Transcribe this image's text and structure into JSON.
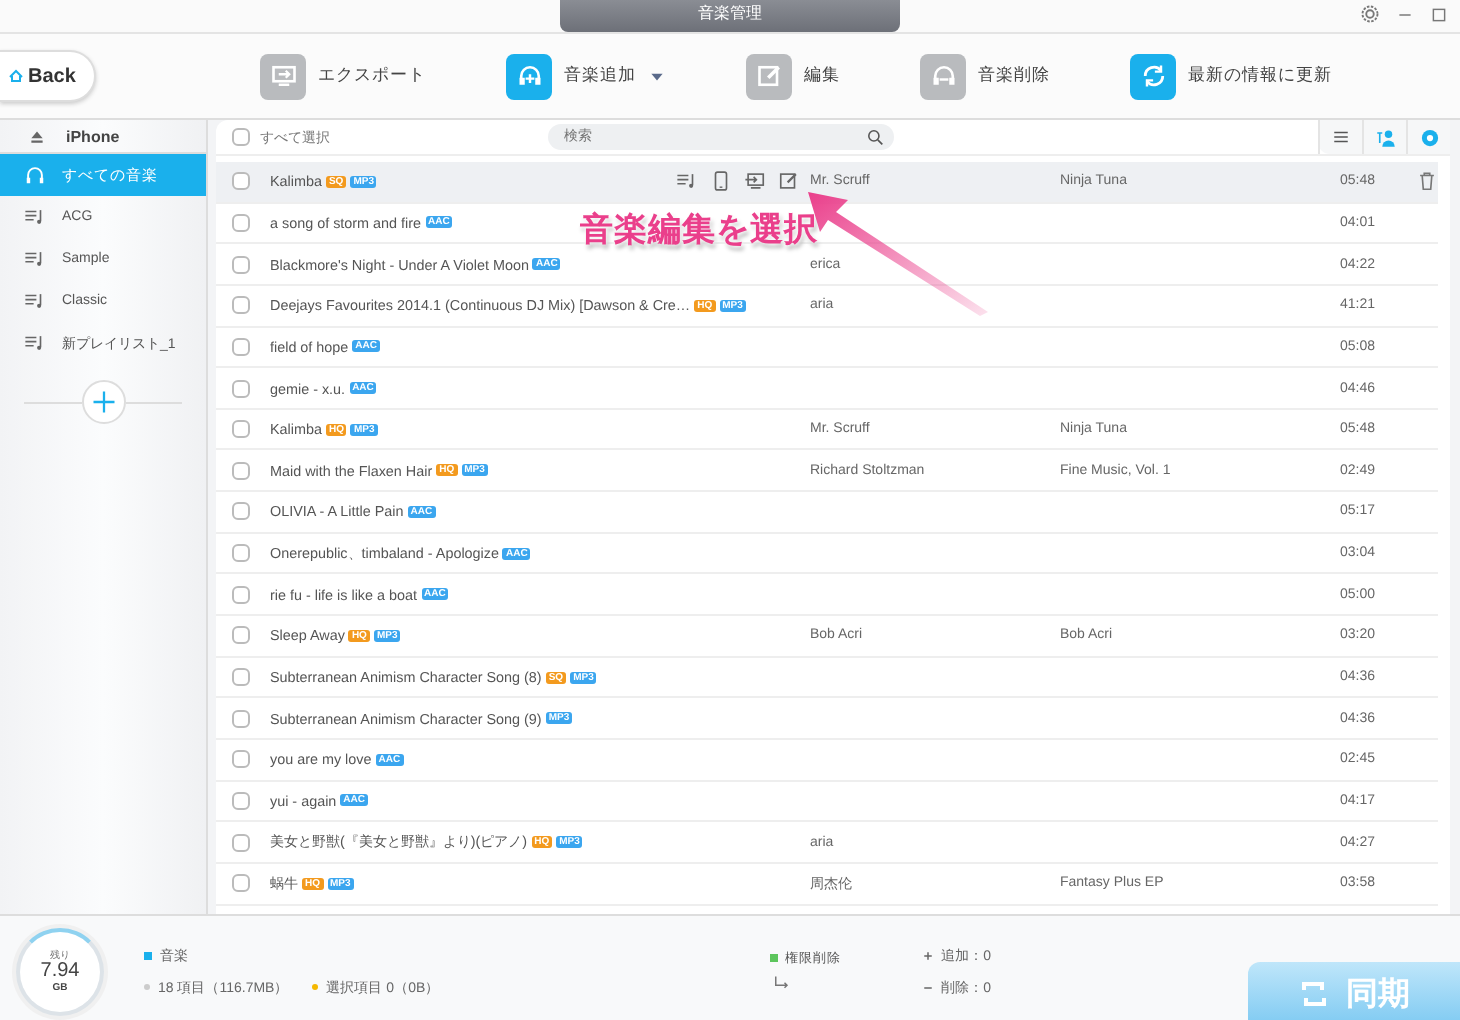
{
  "window": {
    "title": "音楽管理"
  },
  "toolbar": {
    "back": "Back",
    "items": [
      {
        "kind": "export",
        "label": "エクスポート",
        "disabled": true,
        "dropdown": false
      },
      {
        "kind": "add",
        "label": "音楽追加",
        "disabled": false,
        "dropdown": true
      },
      {
        "kind": "edit",
        "label": "編集",
        "disabled": true,
        "dropdown": false
      },
      {
        "kind": "delete",
        "label": "音楽削除",
        "disabled": true,
        "dropdown": false
      },
      {
        "kind": "refresh",
        "label": "最新の情報に更新",
        "disabled": false,
        "dropdown": false
      }
    ]
  },
  "sidebar": {
    "device": "iPhone",
    "items": [
      {
        "kind": "all",
        "label": "すべての音楽",
        "selected": true
      },
      {
        "kind": "playlist",
        "label": "ACG",
        "selected": false
      },
      {
        "kind": "playlist",
        "label": "Sample",
        "selected": false
      },
      {
        "kind": "playlist",
        "label": "Classic",
        "selected": false
      },
      {
        "kind": "playlist",
        "label": "新プレイリスト_1",
        "selected": false
      }
    ]
  },
  "list_header": {
    "select_all": {
      "label": "すべて選択",
      "checked": false
    },
    "search": {
      "placeholder": "検索"
    }
  },
  "rows": [
    {
      "title": "Kalimba",
      "tags": [
        {
          "label": "SQ",
          "kind": "quality"
        },
        {
          "label": "MP3",
          "kind": "format"
        }
      ],
      "artist": "Mr. Scruff",
      "album": "Ninja Tuna",
      "duration": "05:48",
      "checked": false,
      "selected": true
    },
    {
      "title": "a song of storm and fire",
      "tags": [
        {
          "label": "AAC",
          "kind": "format"
        }
      ],
      "duration": "04:01",
      "checked": false,
      "selected": false
    },
    {
      "title": "Blackmore's Night - Under A Violet Moon",
      "tags": [
        {
          "label": "AAC",
          "kind": "format"
        }
      ],
      "artist": "erica",
      "duration": "04:22",
      "checked": false,
      "selected": false
    },
    {
      "title": "Deejays Favourites 2014.1 (Continuous DJ Mix) [Dawson & Cre…",
      "tags": [
        {
          "label": "HQ",
          "kind": "quality"
        },
        {
          "label": "MP3",
          "kind": "format"
        }
      ],
      "artist": "aria",
      "duration": "41:21",
      "checked": false,
      "selected": false
    },
    {
      "title": "field of hope",
      "tags": [
        {
          "label": "AAC",
          "kind": "format"
        }
      ],
      "duration": "05:08",
      "checked": false,
      "selected": false
    },
    {
      "title": "gemie - x.u.",
      "tags": [
        {
          "label": "AAC",
          "kind": "format"
        }
      ],
      "duration": "04:46",
      "checked": false,
      "selected": false
    },
    {
      "title": "Kalimba",
      "tags": [
        {
          "label": "HQ",
          "kind": "quality"
        },
        {
          "label": "MP3",
          "kind": "format"
        }
      ],
      "artist": "Mr. Scruff",
      "album": "Ninja Tuna",
      "duration": "05:48",
      "checked": false,
      "selected": false
    },
    {
      "title": "Maid with the Flaxen Hair",
      "tags": [
        {
          "label": "HQ",
          "kind": "quality"
        },
        {
          "label": "MP3",
          "kind": "format"
        }
      ],
      "artist": "Richard Stoltzman",
      "album": "Fine Music, Vol. 1",
      "duration": "02:49",
      "checked": false,
      "selected": false
    },
    {
      "title": "OLIVIA - A Little Pain",
      "tags": [
        {
          "label": "AAC",
          "kind": "format"
        }
      ],
      "duration": "05:17",
      "checked": false,
      "selected": false
    },
    {
      "title": "Onerepublic、timbaland - Apologize",
      "tags": [
        {
          "label": "AAC",
          "kind": "format"
        }
      ],
      "duration": "03:04",
      "checked": false,
      "selected": false
    },
    {
      "title": "rie fu - life is like a boat",
      "tags": [
        {
          "label": "AAC",
          "kind": "format"
        }
      ],
      "duration": "05:00",
      "checked": false,
      "selected": false
    },
    {
      "title": "Sleep Away",
      "tags": [
        {
          "label": "HQ",
          "kind": "quality"
        },
        {
          "label": "MP3",
          "kind": "format"
        }
      ],
      "artist": "Bob Acri",
      "album": "Bob Acri",
      "duration": "03:20",
      "checked": false,
      "selected": false
    },
    {
      "title": "Subterranean Animism Character Song (8)",
      "tags": [
        {
          "label": "SQ",
          "kind": "quality"
        },
        {
          "label": "MP3",
          "kind": "format"
        }
      ],
      "duration": "04:36",
      "checked": false,
      "selected": false
    },
    {
      "title": "Subterranean Animism Character Song (9)",
      "tags": [
        {
          "label": "MP3",
          "kind": "format"
        }
      ],
      "duration": "04:36",
      "checked": false,
      "selected": false
    },
    {
      "title": "you are my love",
      "tags": [
        {
          "label": "AAC",
          "kind": "format"
        }
      ],
      "duration": "02:45",
      "checked": false,
      "selected": false
    },
    {
      "title": "yui - again",
      "tags": [
        {
          "label": "AAC",
          "kind": "format"
        }
      ],
      "duration": "04:17",
      "checked": false,
      "selected": false
    },
    {
      "title": "美女と野獣(『美女と野獣』より)(ピアノ)",
      "tags": [
        {
          "label": "HQ",
          "kind": "quality"
        },
        {
          "label": "MP3",
          "kind": "format"
        }
      ],
      "artist": "aria",
      "duration": "04:27",
      "checked": false,
      "selected": false
    },
    {
      "title": "蜗牛",
      "tags": [
        {
          "label": "HQ",
          "kind": "quality"
        },
        {
          "label": "MP3",
          "kind": "format"
        }
      ],
      "artist": "周杰伦",
      "album": "Fantasy Plus EP",
      "duration": "03:58",
      "checked": false,
      "selected": false
    }
  ],
  "annotation": {
    "text": "音楽編集を選択"
  },
  "footer": {
    "storage": {
      "label": "残り",
      "value": "7.94",
      "unit": "GB"
    },
    "category": "音楽",
    "count": "18 項目（116.7MB）",
    "selection": "選択項目 0（0B）",
    "permission": "権限削除",
    "added": "追加：0",
    "removed": "削除：0",
    "sync": "同期"
  }
}
